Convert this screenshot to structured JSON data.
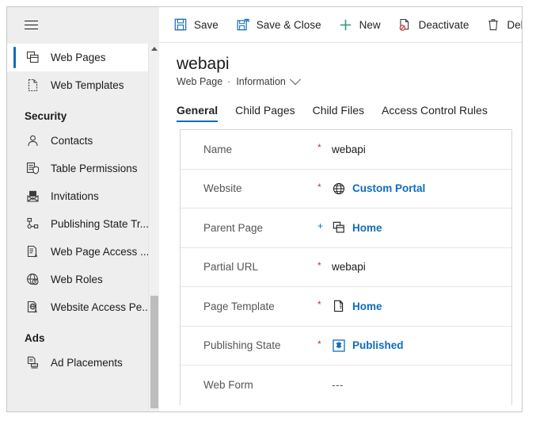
{
  "colors": {
    "accent": "#0f6cbd",
    "required_red": "#c4314b",
    "sidebar_bg": "#eeeeee",
    "link_blue": "#0f6cbd",
    "new_green": "#3aa17e"
  },
  "sidebar": {
    "menu_icon": "hamburger-icon",
    "items": [
      {
        "label": "Web Pages",
        "icon": "web-pages-icon",
        "selected": true
      },
      {
        "label": "Web Templates",
        "icon": "web-templates-icon",
        "selected": false
      }
    ],
    "groups": [
      {
        "title": "Security",
        "items": [
          {
            "label": "Contacts",
            "icon": "contact-icon"
          },
          {
            "label": "Table  Permissions",
            "icon": "table-permissions-icon"
          },
          {
            "label": "Invitations",
            "icon": "invitations-icon"
          },
          {
            "label": "Publishing State Tr...",
            "icon": "publishing-state-transition-icon"
          },
          {
            "label": "Web Page Access ...",
            "icon": "web-page-access-icon"
          },
          {
            "label": "Web Roles",
            "icon": "web-roles-icon"
          },
          {
            "label": "Website Access Pe...",
            "icon": "website-access-icon"
          }
        ]
      },
      {
        "title": "Ads",
        "items": [
          {
            "label": "Ad Placements",
            "icon": "ad-placements-icon"
          }
        ]
      }
    ]
  },
  "commandbar": {
    "commands": [
      {
        "label": "Save",
        "icon": "save-icon"
      },
      {
        "label": "Save & Close",
        "icon": "save-and-close-icon"
      },
      {
        "label": "New",
        "icon": "plus-icon"
      },
      {
        "label": "Deactivate",
        "icon": "deactivate-icon"
      },
      {
        "label": "Del",
        "icon": "delete-icon"
      }
    ]
  },
  "record": {
    "title": "webapi",
    "entity": "Web Page",
    "separator": "·",
    "form_name": "Information"
  },
  "tabs": [
    {
      "label": "General",
      "active": true
    },
    {
      "label": "Child Pages",
      "active": false
    },
    {
      "label": "Child Files",
      "active": false
    },
    {
      "label": "Access Control Rules",
      "active": false
    }
  ],
  "form": {
    "rows": [
      {
        "label": "Name",
        "marker": "*",
        "marker_type": "required",
        "value": "webapi",
        "is_link": false,
        "icon": null
      },
      {
        "label": "Website",
        "marker": "*",
        "marker_type": "required",
        "value": "Custom Portal",
        "is_link": true,
        "icon": "globe-icon"
      },
      {
        "label": "Parent Page",
        "marker": "+",
        "marker_type": "recommended",
        "value": "Home",
        "is_link": true,
        "icon": "web-pages-icon"
      },
      {
        "label": "Partial URL",
        "marker": "*",
        "marker_type": "required",
        "value": "webapi",
        "is_link": false,
        "icon": null
      },
      {
        "label": "Page Template",
        "marker": "*",
        "marker_type": "required",
        "value": "Home",
        "is_link": true,
        "icon": "page-template-icon"
      },
      {
        "label": "Publishing State",
        "marker": "*",
        "marker_type": "required",
        "value": "Published",
        "is_link": true,
        "icon": "publishing-state-icon"
      },
      {
        "label": "Web Form",
        "marker": "",
        "marker_type": "none",
        "value": "---",
        "is_link": false,
        "icon": null
      }
    ]
  },
  "scrollbar": {
    "up_arrow": "scroll-up-arrow"
  }
}
